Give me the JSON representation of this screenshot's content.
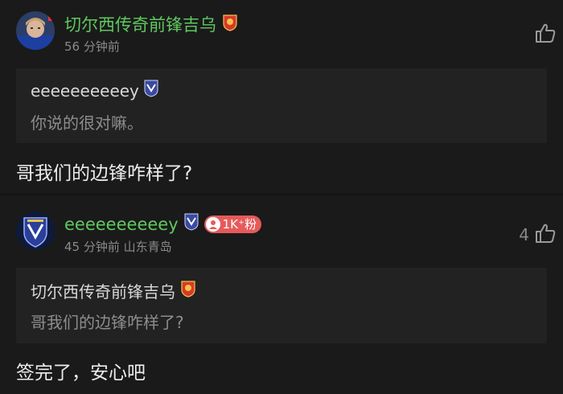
{
  "comments": [
    {
      "username": "切尔西传奇前锋吉乌",
      "time": "56 分钟前",
      "location": "",
      "likes": "",
      "quote": {
        "user": "eeeeeeeeeey",
        "text": "你说的很对嘛。"
      },
      "text": "哥我们的边锋咋样了?"
    },
    {
      "username": "eeeeeeeeeey",
      "fan_badge": "1K⁺粉",
      "time": "45 分钟前",
      "location": "山东青岛",
      "likes": "4",
      "quote": {
        "user": "切尔西传奇前锋吉乌",
        "text": "哥我们的边锋咋样了?"
      },
      "text": "签完了，安心吧"
    }
  ],
  "colors": {
    "background": "#1a1a1a",
    "username": "#5fc85f",
    "quote_bg": "#222222",
    "fan_badge": "#e65a5a",
    "shanghai_badge": "#d63a2a",
    "shandong_badge": "#3a4aa0"
  },
  "icons": [
    "thumb-up-icon",
    "shanghai-port-badge-icon",
    "shandong-taishan-badge-icon",
    "fan-person-icon"
  ]
}
